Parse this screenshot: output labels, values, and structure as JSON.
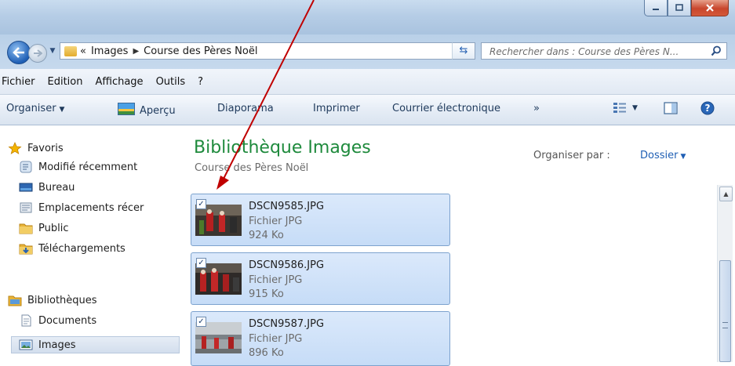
{
  "window": {
    "buttons": {
      "minimize_icon": "minimize-icon",
      "maximize_icon": "maximize-icon",
      "close_icon": "close-icon"
    }
  },
  "address": {
    "chevron": "«",
    "crumbs": [
      "Images",
      "Course des Pères Noël"
    ],
    "search_placeholder": "Rechercher dans : Course des Pères N..."
  },
  "menu": [
    "Fichier",
    "Edition",
    "Affichage",
    "Outils",
    "?"
  ],
  "commands": {
    "organise": "Organiser",
    "preview": "Aperçu",
    "slideshow": "Diaporama",
    "print": "Imprimer",
    "email": "Courrier électronique",
    "more": "»"
  },
  "nav": {
    "favorites_label": "Favoris",
    "favorites": [
      "Modifié récemment",
      "Bureau",
      "Emplacements récer",
      "Public",
      "Téléchargements"
    ],
    "libraries_label": "Bibliothèques",
    "libraries": [
      "Documents",
      "Images"
    ]
  },
  "content": {
    "title": "Bibliothèque Images",
    "subtitle": "Course des Pères Noël",
    "arrange_label": "Organiser par :",
    "arrange_value": "Dossier"
  },
  "files": [
    {
      "name": "DSCN9585.JPG",
      "type": "Fichier JPG",
      "size": "924 Ko",
      "checked": true
    },
    {
      "name": "DSCN9586.JPG",
      "type": "Fichier JPG",
      "size": "915 Ko",
      "checked": true
    },
    {
      "name": "DSCN9587.JPG",
      "type": "Fichier JPG",
      "size": "896 Ko",
      "checked": true
    }
  ],
  "colors": {
    "library_title": "#1e8a3c",
    "link_blue": "#1f5fb4",
    "selection_fill": "#c6dcf7",
    "annotation_arrow": "#c00000"
  }
}
